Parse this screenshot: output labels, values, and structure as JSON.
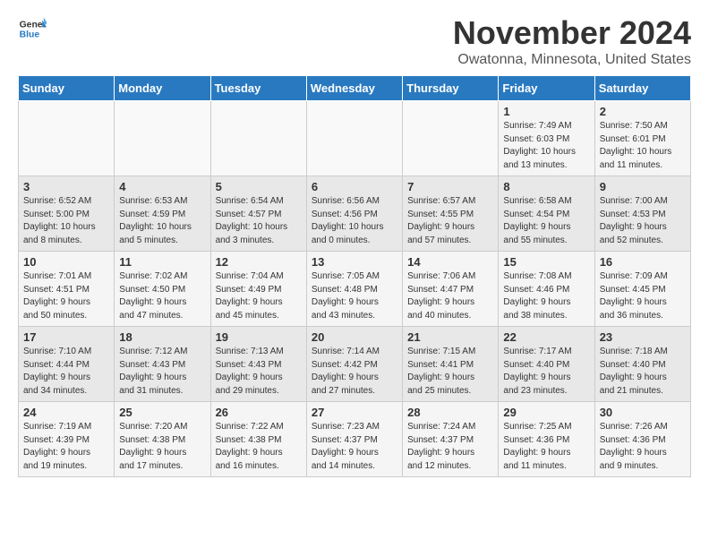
{
  "header": {
    "logo": {
      "general": "General",
      "blue": "Blue"
    },
    "month": "November 2024",
    "location": "Owatonna, Minnesota, United States"
  },
  "weekdays": [
    "Sunday",
    "Monday",
    "Tuesday",
    "Wednesday",
    "Thursday",
    "Friday",
    "Saturday"
  ],
  "weeks": [
    [
      {
        "day": "",
        "info": ""
      },
      {
        "day": "",
        "info": ""
      },
      {
        "day": "",
        "info": ""
      },
      {
        "day": "",
        "info": ""
      },
      {
        "day": "",
        "info": ""
      },
      {
        "day": "1",
        "info": "Sunrise: 7:49 AM\nSunset: 6:03 PM\nDaylight: 10 hours\nand 13 minutes."
      },
      {
        "day": "2",
        "info": "Sunrise: 7:50 AM\nSunset: 6:01 PM\nDaylight: 10 hours\nand 11 minutes."
      }
    ],
    [
      {
        "day": "3",
        "info": "Sunrise: 6:52 AM\nSunset: 5:00 PM\nDaylight: 10 hours\nand 8 minutes."
      },
      {
        "day": "4",
        "info": "Sunrise: 6:53 AM\nSunset: 4:59 PM\nDaylight: 10 hours\nand 5 minutes."
      },
      {
        "day": "5",
        "info": "Sunrise: 6:54 AM\nSunset: 4:57 PM\nDaylight: 10 hours\nand 3 minutes."
      },
      {
        "day": "6",
        "info": "Sunrise: 6:56 AM\nSunset: 4:56 PM\nDaylight: 10 hours\nand 0 minutes."
      },
      {
        "day": "7",
        "info": "Sunrise: 6:57 AM\nSunset: 4:55 PM\nDaylight: 9 hours\nand 57 minutes."
      },
      {
        "day": "8",
        "info": "Sunrise: 6:58 AM\nSunset: 4:54 PM\nDaylight: 9 hours\nand 55 minutes."
      },
      {
        "day": "9",
        "info": "Sunrise: 7:00 AM\nSunset: 4:53 PM\nDaylight: 9 hours\nand 52 minutes."
      }
    ],
    [
      {
        "day": "10",
        "info": "Sunrise: 7:01 AM\nSunset: 4:51 PM\nDaylight: 9 hours\nand 50 minutes."
      },
      {
        "day": "11",
        "info": "Sunrise: 7:02 AM\nSunset: 4:50 PM\nDaylight: 9 hours\nand 47 minutes."
      },
      {
        "day": "12",
        "info": "Sunrise: 7:04 AM\nSunset: 4:49 PM\nDaylight: 9 hours\nand 45 minutes."
      },
      {
        "day": "13",
        "info": "Sunrise: 7:05 AM\nSunset: 4:48 PM\nDaylight: 9 hours\nand 43 minutes."
      },
      {
        "day": "14",
        "info": "Sunrise: 7:06 AM\nSunset: 4:47 PM\nDaylight: 9 hours\nand 40 minutes."
      },
      {
        "day": "15",
        "info": "Sunrise: 7:08 AM\nSunset: 4:46 PM\nDaylight: 9 hours\nand 38 minutes."
      },
      {
        "day": "16",
        "info": "Sunrise: 7:09 AM\nSunset: 4:45 PM\nDaylight: 9 hours\nand 36 minutes."
      }
    ],
    [
      {
        "day": "17",
        "info": "Sunrise: 7:10 AM\nSunset: 4:44 PM\nDaylight: 9 hours\nand 34 minutes."
      },
      {
        "day": "18",
        "info": "Sunrise: 7:12 AM\nSunset: 4:43 PM\nDaylight: 9 hours\nand 31 minutes."
      },
      {
        "day": "19",
        "info": "Sunrise: 7:13 AM\nSunset: 4:43 PM\nDaylight: 9 hours\nand 29 minutes."
      },
      {
        "day": "20",
        "info": "Sunrise: 7:14 AM\nSunset: 4:42 PM\nDaylight: 9 hours\nand 27 minutes."
      },
      {
        "day": "21",
        "info": "Sunrise: 7:15 AM\nSunset: 4:41 PM\nDaylight: 9 hours\nand 25 minutes."
      },
      {
        "day": "22",
        "info": "Sunrise: 7:17 AM\nSunset: 4:40 PM\nDaylight: 9 hours\nand 23 minutes."
      },
      {
        "day": "23",
        "info": "Sunrise: 7:18 AM\nSunset: 4:40 PM\nDaylight: 9 hours\nand 21 minutes."
      }
    ],
    [
      {
        "day": "24",
        "info": "Sunrise: 7:19 AM\nSunset: 4:39 PM\nDaylight: 9 hours\nand 19 minutes."
      },
      {
        "day": "25",
        "info": "Sunrise: 7:20 AM\nSunset: 4:38 PM\nDaylight: 9 hours\nand 17 minutes."
      },
      {
        "day": "26",
        "info": "Sunrise: 7:22 AM\nSunset: 4:38 PM\nDaylight: 9 hours\nand 16 minutes."
      },
      {
        "day": "27",
        "info": "Sunrise: 7:23 AM\nSunset: 4:37 PM\nDaylight: 9 hours\nand 14 minutes."
      },
      {
        "day": "28",
        "info": "Sunrise: 7:24 AM\nSunset: 4:37 PM\nDaylight: 9 hours\nand 12 minutes."
      },
      {
        "day": "29",
        "info": "Sunrise: 7:25 AM\nSunset: 4:36 PM\nDaylight: 9 hours\nand 11 minutes."
      },
      {
        "day": "30",
        "info": "Sunrise: 7:26 AM\nSunset: 4:36 PM\nDaylight: 9 hours\nand 9 minutes."
      }
    ]
  ]
}
